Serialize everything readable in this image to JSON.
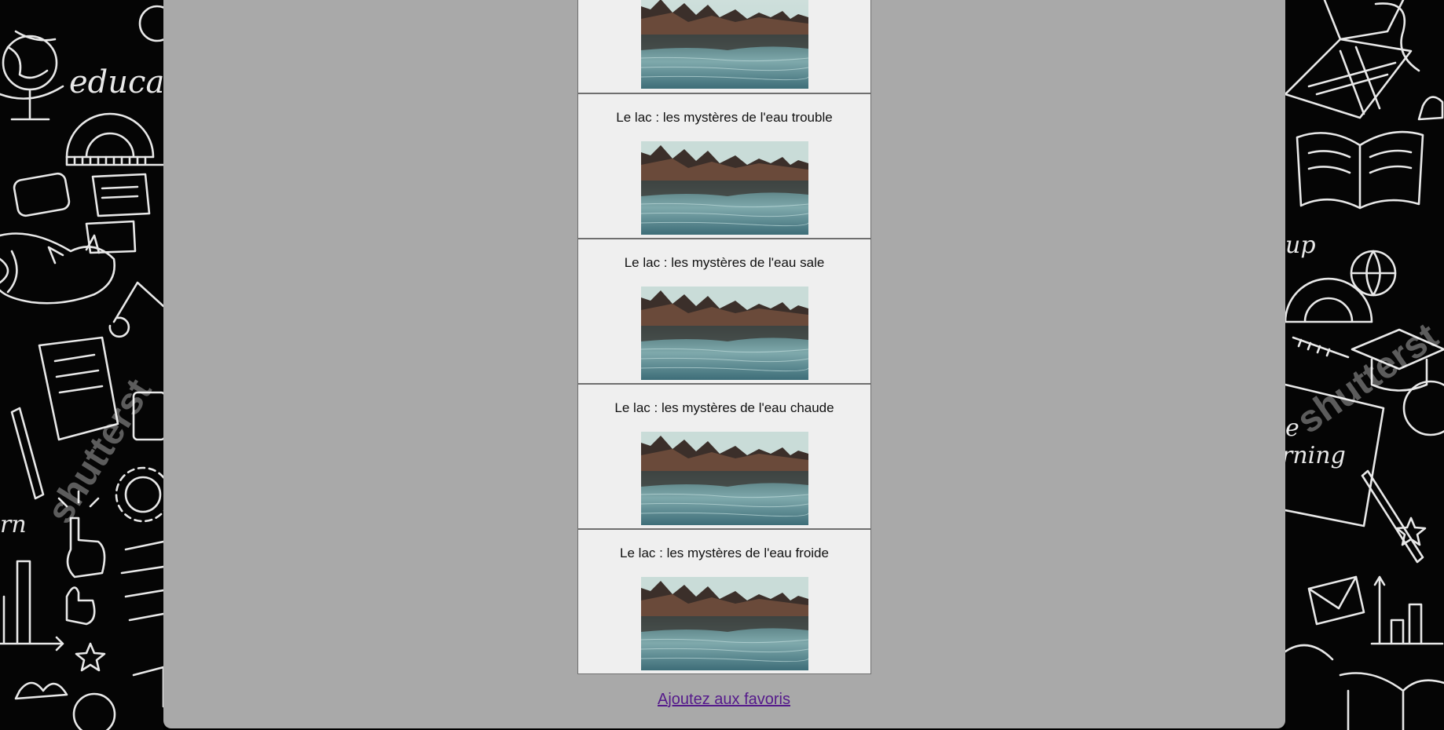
{
  "articles": [
    {
      "title": "",
      "image_alt": "lake-photo"
    },
    {
      "title": "Le lac : les mystères de l'eau trouble",
      "image_alt": "lake-photo"
    },
    {
      "title": "Le lac : les mystères de l'eau sale",
      "image_alt": "lake-photo"
    },
    {
      "title": "Le lac : les mystères de l'eau chaude",
      "image_alt": "lake-photo"
    },
    {
      "title": "Le lac : les mystères de l'eau froide",
      "image_alt": "lake-photo"
    }
  ],
  "favorites_link": "Ajoutez aux favoris",
  "background": {
    "left_words": [
      "educat",
      "rn"
    ],
    "right_words": [
      "up",
      "e",
      "rning"
    ],
    "watermark": "shutterst"
  },
  "colors": {
    "panel": "#a9a9a9",
    "card": "#efefef",
    "link_visited": "#551a8b",
    "sidebar": "#050505"
  }
}
